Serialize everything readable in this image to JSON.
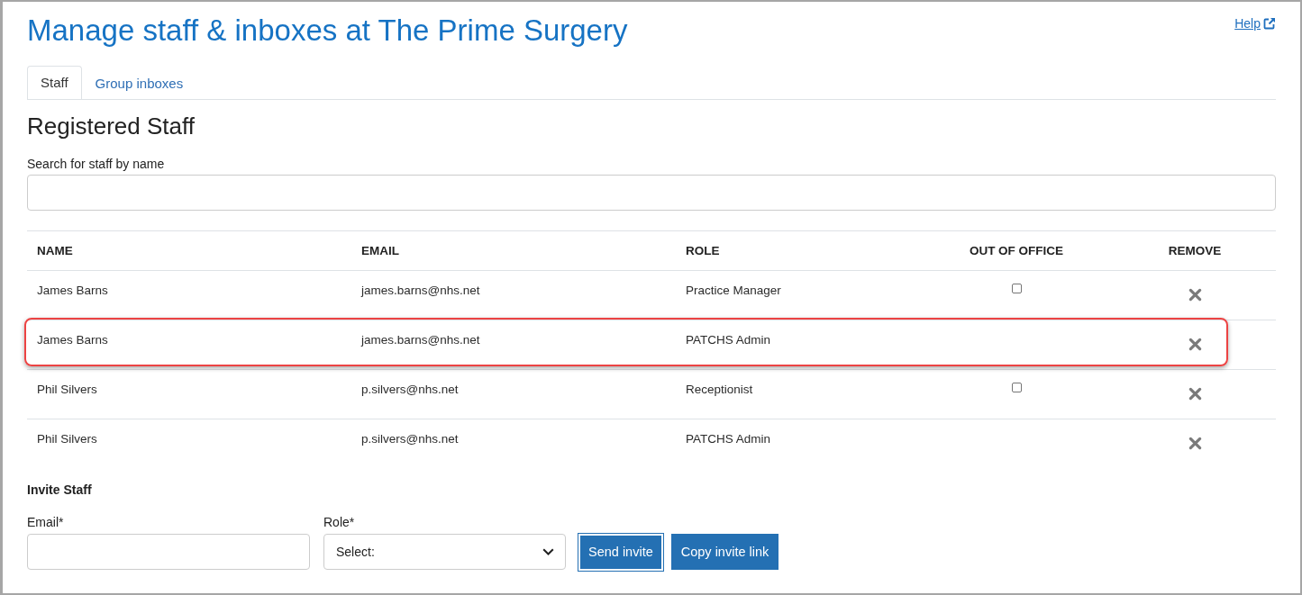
{
  "page": {
    "title": "Manage staff & inboxes at The Prime Surgery",
    "help_link": "Help"
  },
  "tabs": [
    {
      "label": "Staff",
      "selected": true
    },
    {
      "label": "Group inboxes",
      "selected": false
    }
  ],
  "section_title": "Registered Staff",
  "search": {
    "label": "Search for staff by name"
  },
  "table": {
    "columns": [
      "NAME",
      "EMAIL",
      "ROLE",
      "OUT OF OFFICE",
      "REMOVE"
    ],
    "rows": [
      {
        "name": "James Barns",
        "email": "james.barns@nhs.net",
        "role": "Practice Manager",
        "out_of_office": {
          "checked": false
        },
        "highlighted": false
      },
      {
        "name": "James Barns",
        "email": "james.barns@nhs.net",
        "role": "PATCHS Admin",
        "highlighted": true
      },
      {
        "name": "Phil Silvers",
        "email": "p.silvers@nhs.net",
        "role": "Receptionist",
        "out_of_office": {
          "checked": false
        },
        "highlighted": false
      },
      {
        "name": "Phil Silvers",
        "email": "p.silvers@nhs.net",
        "role": "PATCHS Admin",
        "highlighted": false
      }
    ]
  },
  "invite": {
    "title": "Invite Staff",
    "email": {
      "label": "Email*"
    },
    "role": {
      "label": "Role*",
      "value": "Select:"
    },
    "buttons": [
      {
        "label": "Send invite",
        "focused": true
      },
      {
        "label": "Copy invite link",
        "focused": false
      }
    ]
  }
}
